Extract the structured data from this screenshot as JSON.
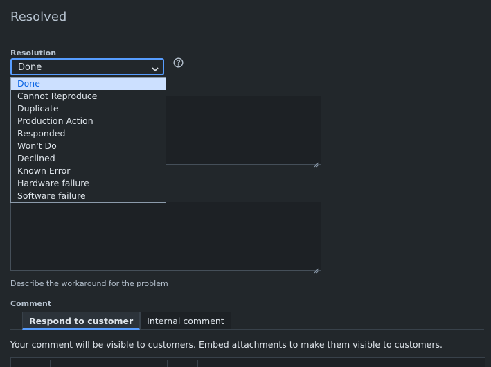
{
  "title": "Resolved",
  "resolution": {
    "label": "Resolution",
    "selected": "Done",
    "options": [
      "Done",
      "Cannot Reproduce",
      "Duplicate",
      "Production Action",
      "Responded",
      "Won't Do",
      "Declined",
      "Known Error",
      "Hardware failure",
      "Software failure"
    ]
  },
  "workaround": {
    "description": "Describe the workaround for the problem"
  },
  "comment": {
    "label": "Comment",
    "tabs": [
      "Respond to customer",
      "Internal comment"
    ],
    "active_tab": "Respond to customer",
    "notice": "Your comment will be visible to customers. Embed attachments to make them visible to customers."
  },
  "icons": {
    "help": "help-circle-icon",
    "chevron": "chevron-down-icon",
    "resize": "resize-handle-icon"
  },
  "colors": {
    "background": "#22272b",
    "accent": "#579dff",
    "selected_option_bg": "#cce0ff",
    "selected_option_text": "#0c66e4"
  }
}
